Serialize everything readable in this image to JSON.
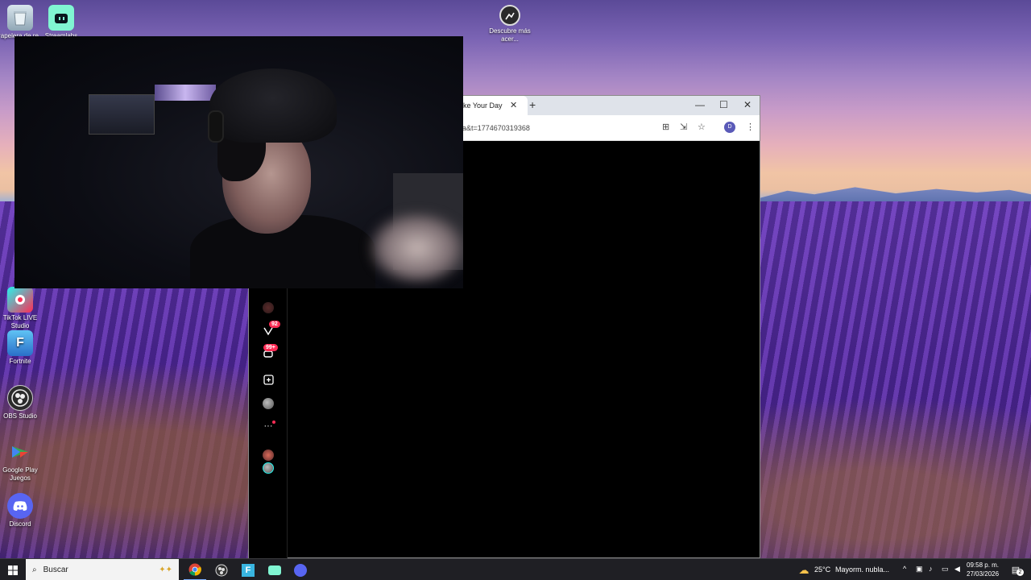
{
  "desktop": {
    "icons": [
      {
        "label": "Papelera de re...",
        "icon": "recycle-bin-icon"
      },
      {
        "label": "Streamlabs",
        "icon": "streamlabs-icon"
      },
      {
        "label": "Descubre más acer...",
        "icon": "discover-icon"
      },
      {
        "label": "TikTok LIVE Studio",
        "icon": "tiktok-live-icon"
      },
      {
        "label": "Fortnite",
        "icon": "fortnite-icon"
      },
      {
        "label": "OBS Studio",
        "icon": "obs-icon"
      },
      {
        "label": "Google Play Juegos",
        "icon": "google-play-games-icon"
      },
      {
        "label": "Discord",
        "icon": "discord-icon"
      }
    ]
  },
  "browser": {
    "tab_title": "ke Your Day",
    "url": "a&t=1774670319368",
    "profile_initial": "D",
    "sidebar": {
      "messages_badge": "92",
      "inbox_badge": "99+",
      "more_label": "···"
    }
  },
  "taskbar": {
    "search_placeholder": "Buscar",
    "weather_temp": "25°C",
    "weather_text": "Mayorm. nubla...",
    "time": "09:58 p. m.",
    "date": "27/03/2026",
    "notifications": "2"
  },
  "colors": {
    "tiktok_red": "#fe2c55",
    "taskbar_bg": "#1f1f24"
  }
}
